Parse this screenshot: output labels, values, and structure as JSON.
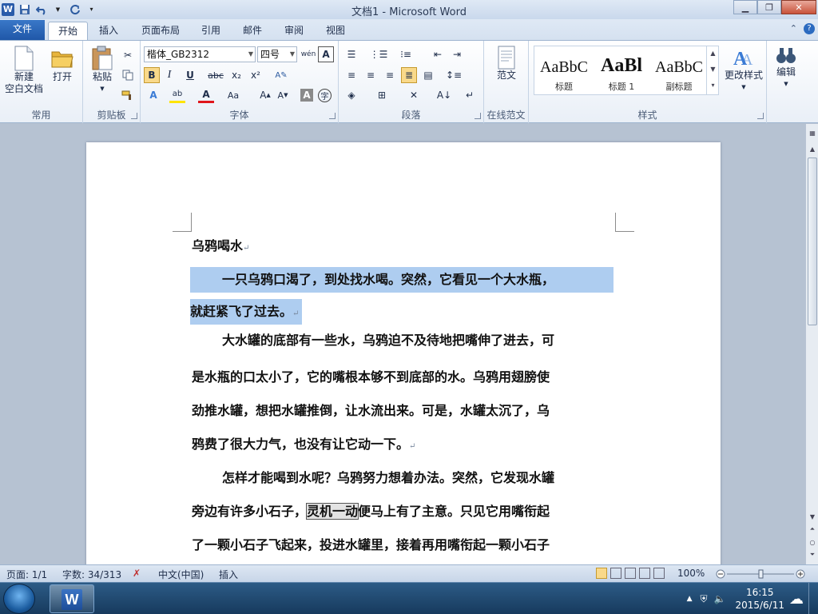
{
  "window": {
    "title": "文档1 - Microsoft Word"
  },
  "quick_access": {
    "app_icon": "word-icon",
    "save": "save-icon",
    "undo": "undo-icon",
    "redo": "redo-icon"
  },
  "tabs": [
    {
      "label": "文件"
    },
    {
      "label": "开始"
    },
    {
      "label": "插入"
    },
    {
      "label": "页面布局"
    },
    {
      "label": "引用"
    },
    {
      "label": "邮件"
    },
    {
      "label": "审阅"
    },
    {
      "label": "视图"
    }
  ],
  "ribbon": {
    "groups": {
      "common": "常用",
      "clipboard": "剪贴板",
      "font": "字体",
      "paragraph": "段落",
      "online": "在线范文",
      "styles": "样式"
    },
    "new_doc": {
      "line1": "新建",
      "line2": "空白文档"
    },
    "open": "打开",
    "paste": "粘贴",
    "font_name": "楷体_GB2312",
    "font_size": "四号",
    "wen": "wén",
    "font_buttons": {
      "bold": "B",
      "italic": "I",
      "underline": "U",
      "strike": "abc",
      "sub": "x₂",
      "sup": "x²"
    },
    "online_sample": "范文",
    "styles": [
      {
        "sample": "AaBbC",
        "name": "标题"
      },
      {
        "sample": "AaBl",
        "name": "标题 1"
      },
      {
        "sample": "AaBbC",
        "name": "副标题"
      }
    ],
    "change_styles": "更改样式",
    "edit": "编辑"
  },
  "document": {
    "lines": [
      {
        "text": "乌鸦喝水",
        "mark": "↵"
      },
      {
        "text": "一只乌鸦口渴了，到处找水喝。突然，它看见一个大水瓶，",
        "mark": ""
      },
      {
        "text": "就赶紧飞了过去。",
        "mark": "↵"
      },
      {
        "text": "大水罐的底部有一些水，乌鸦迫不及待地把嘴伸了进去，可",
        "mark": ""
      },
      {
        "text": "是水瓶的口太小了，它的嘴根本够不到底部的水。乌鸦用翅膀使",
        "mark": ""
      },
      {
        "text": "劲推水罐，想把水罐推倒，让水流出来。可是，水罐太沉了，乌",
        "mark": ""
      },
      {
        "text": "鸦费了很大力气，也没有让它动一下。",
        "mark": "↵"
      },
      {
        "text": "怎样才能喝到水呢？乌鸦努力想着办法。突然，它发现水罐",
        "mark": ""
      },
      {
        "text_before": "旁边有许多小石子，",
        "boxed": "灵机一动",
        "text_after": "便马上有了主意。只见它用嘴衔起",
        "mark": ""
      },
      {
        "text": "了一颗小石子飞起来，投进水罐里，接着再用嘴衔起一颗小石子",
        "mark": ""
      }
    ]
  },
  "status": {
    "page": "页面: 1/1",
    "words": "字数: 34/313",
    "language": "中文(中国)",
    "mode": "插入",
    "zoom": "100%"
  },
  "taskbar": {
    "time": "16:15",
    "date": "2015/6/11"
  }
}
